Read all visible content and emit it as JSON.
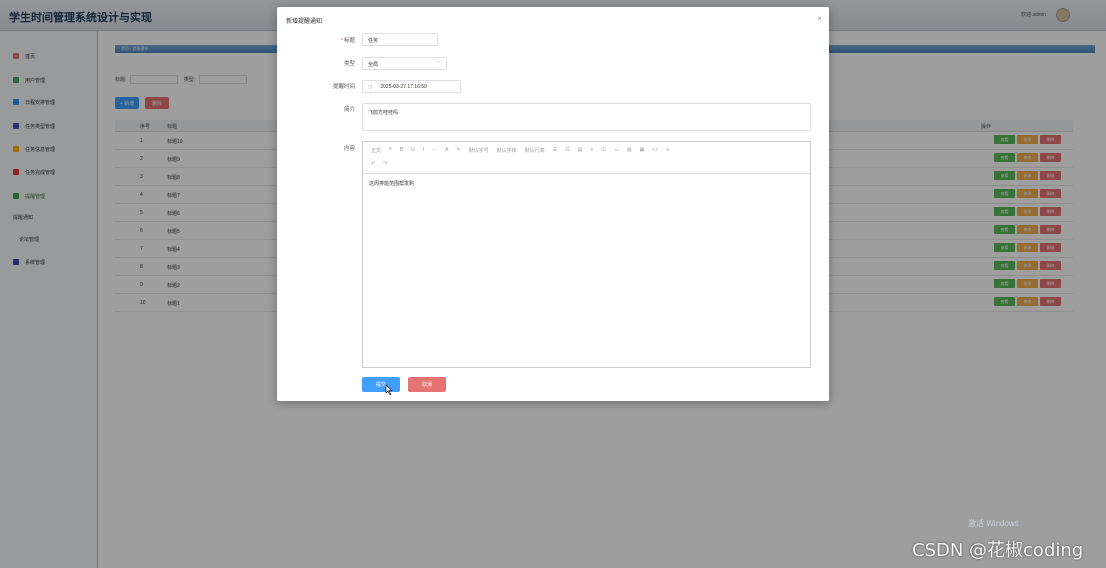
{
  "app": {
    "title": "学生时间管理系统设计与实现",
    "welcome": "欢迎 admin"
  },
  "sidebar": {
    "items": [
      {
        "label": "首页",
        "color": "#e57373"
      },
      {
        "label": "用户管理",
        "color": "#4caf50"
      },
      {
        "label": "日程安排管理",
        "color": "#2196f3"
      },
      {
        "label": "任务类型管理",
        "color": "#3f51b5"
      },
      {
        "label": "任务信息管理",
        "color": "#ffb300"
      },
      {
        "label": "任务完成管理",
        "color": "#e53935"
      },
      {
        "label": "提醒管理",
        "color": "#43a047"
      },
      {
        "label": "提醒通知",
        "color": ""
      },
      {
        "label": "论坛管理",
        "color": ""
      },
      {
        "label": "系统管理",
        "color": "#3949ab"
      }
    ]
  },
  "main": {
    "breadcrumb": "首页 / 提醒通知",
    "filter": {
      "title_label": "标题:",
      "type_label": "类型:"
    },
    "buttons": {
      "add": "+ 新增",
      "delete": "删除"
    },
    "table": {
      "headers": {
        "index": "序号",
        "title": "标题",
        "actions": "操作"
      },
      "rows": [
        {
          "index": "1",
          "title": "标题10"
        },
        {
          "index": "2",
          "title": "标题9"
        },
        {
          "index": "3",
          "title": "标题8"
        },
        {
          "index": "4",
          "title": "标题7"
        },
        {
          "index": "5",
          "title": "标题6"
        },
        {
          "index": "6",
          "title": "标题5"
        },
        {
          "index": "7",
          "title": "标题4"
        },
        {
          "index": "8",
          "title": "标题3"
        },
        {
          "index": "9",
          "title": "标题2"
        },
        {
          "index": "10",
          "title": "标题1"
        }
      ],
      "row_actions": {
        "view": "查看",
        "edit": "修改",
        "delete": "删除"
      }
    }
  },
  "dialog": {
    "title": "新增提醒通知",
    "fields": {
      "title": {
        "label": "标题",
        "value": "任务"
      },
      "type": {
        "label": "类型",
        "value": "全局"
      },
      "time": {
        "label": "提醒时间",
        "value": "2025-03-27 17:16:59"
      },
      "summary": {
        "label": "简介",
        "value": "飞鸽方哇哇吗"
      },
      "content": {
        "label": "内容",
        "value": "这周排能范围帮发购"
      }
    },
    "editor_toolbar": {
      "row1": [
        "正文",
        "❝",
        "B",
        "U",
        "I",
        "···",
        "A",
        "✎",
        "默认字号",
        "默认字体",
        "默认行高",
        "☰",
        "☷",
        "▤",
        "≡",
        "☑",
        "☺",
        "▨",
        "▦",
        "<>",
        "≡"
      ],
      "row2": [
        "↶",
        "↷"
      ]
    },
    "submit": "提交",
    "cancel": "取消"
  },
  "watermark": {
    "windows": "激活 Windows",
    "csdn": "CSDN @花椒coding"
  },
  "colors": {
    "primary": "#409eff",
    "danger": "#e57373",
    "success": "#5cb85c",
    "warning": "#f0ad4e"
  }
}
